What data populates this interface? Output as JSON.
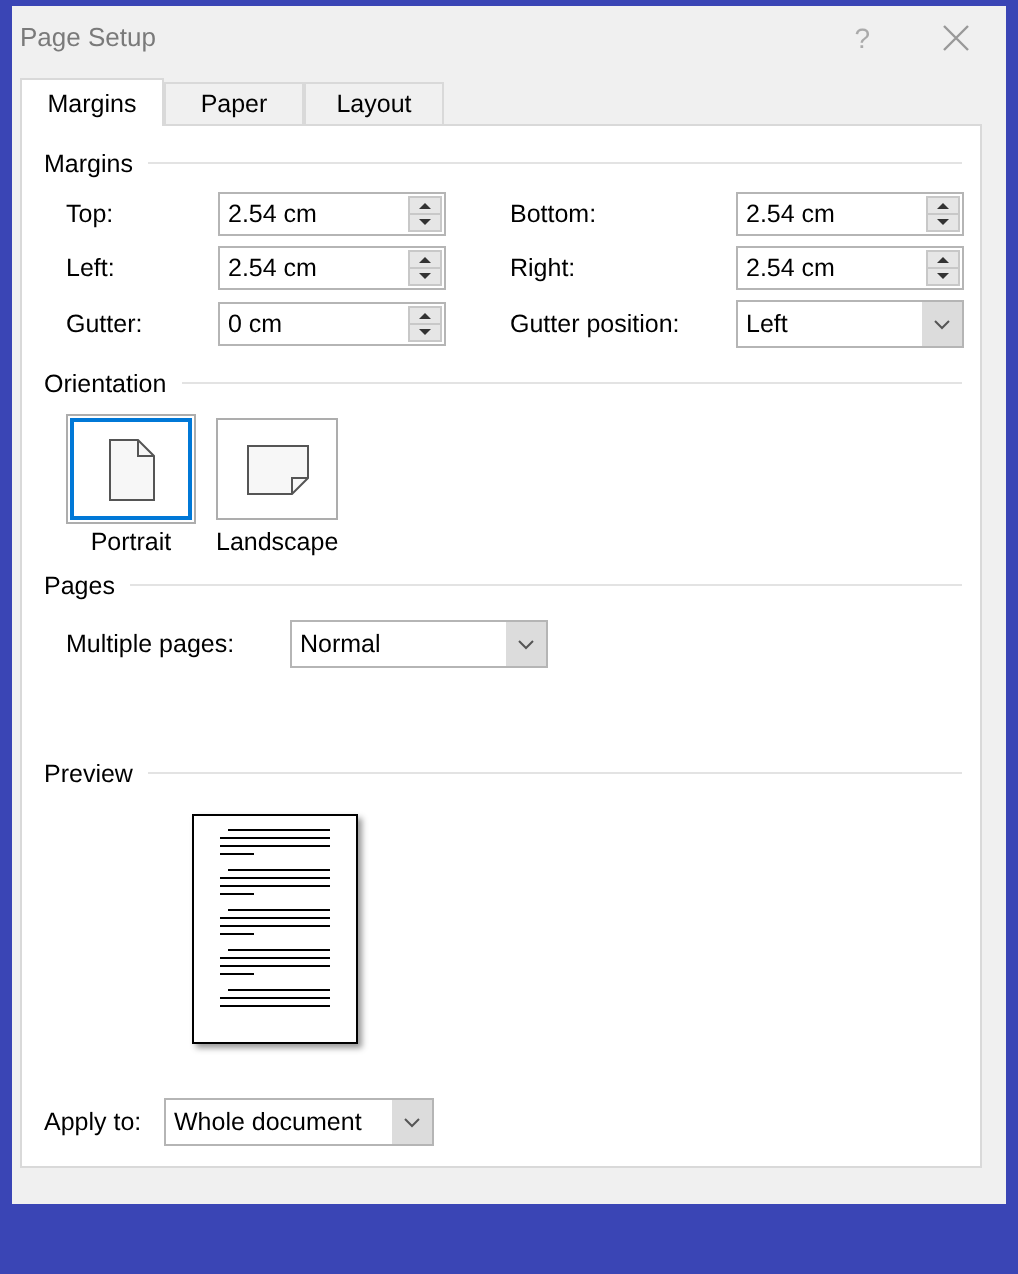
{
  "window": {
    "title": "Page Setup",
    "help": "?"
  },
  "tabs": [
    {
      "label": "Margins",
      "selected": true
    },
    {
      "label": "Paper",
      "selected": false
    },
    {
      "label": "Layout",
      "selected": false
    }
  ],
  "margins": {
    "title": "Margins",
    "fields": [
      {
        "kind": "spin",
        "label": "Top:",
        "value": "2.54 cm"
      },
      {
        "kind": "spin",
        "label": "Bottom:",
        "value": "2.54 cm"
      },
      {
        "kind": "spin",
        "label": "Left:",
        "value": "2.54 cm"
      },
      {
        "kind": "spin",
        "label": "Right:",
        "value": "2.54 cm"
      },
      {
        "kind": "spin",
        "label": "Gutter:",
        "value": "0 cm"
      },
      {
        "kind": "combo",
        "label": "Gutter position:",
        "value": "Left"
      }
    ]
  },
  "orientation": {
    "title": "Orientation",
    "options": [
      {
        "kind": "portrait",
        "label": "Portrait",
        "selected": true
      },
      {
        "kind": "landscape",
        "label": "Landscape",
        "selected": false
      }
    ]
  },
  "pages": {
    "title": "Pages",
    "multiple_pages": {
      "label": "Multiple pages:",
      "value": "Normal"
    }
  },
  "preview": {
    "title": "Preview"
  },
  "apply_to": {
    "label": "Apply to:",
    "value": "Whole document"
  }
}
